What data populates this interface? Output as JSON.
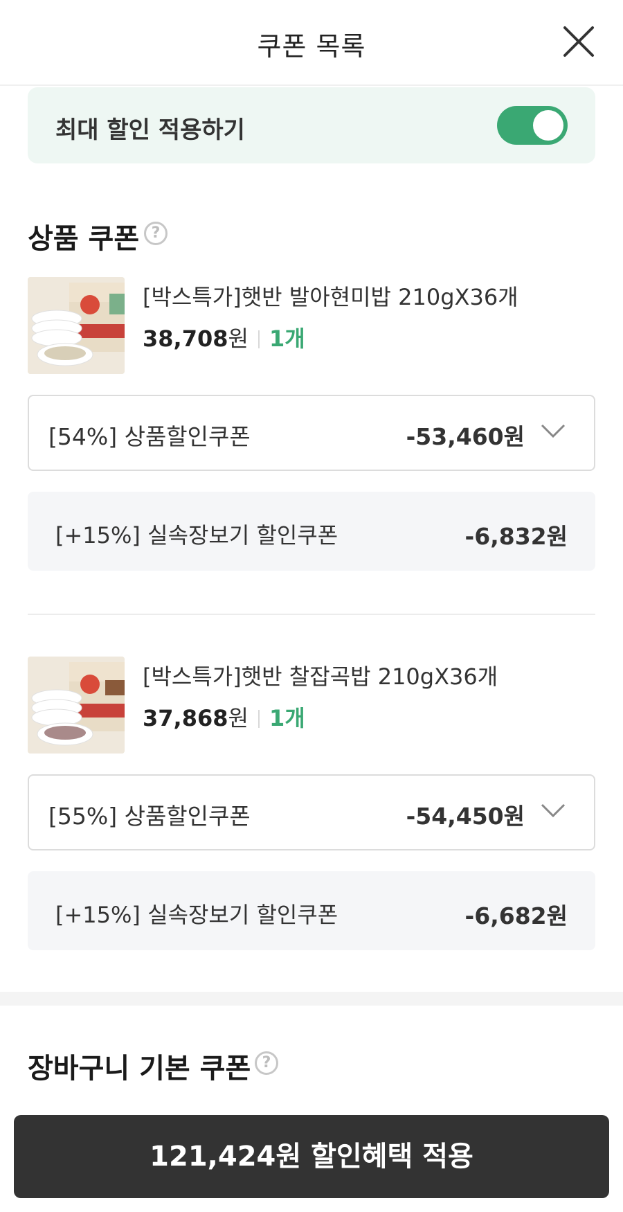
{
  "header": {
    "title": "쿠폰 목록"
  },
  "max_discount": {
    "label": "최대 할인 적용하기",
    "enabled": true
  },
  "product_coupon_section": {
    "title": "상품 쿠폰",
    "help": "?",
    "items": [
      {
        "name": "[박스특가]햇반 발아현미밥 210gX36개",
        "price": "38,708",
        "currency": "원",
        "quantity": "1개",
        "selected_coupon": {
          "name": "[54%] 상품할인쿠폰",
          "amount": "-53,460원"
        },
        "extra_coupon": {
          "name": "[+15%] 실속장보기 할인쿠폰",
          "amount": "-6,832원"
        }
      },
      {
        "name": "[박스특가]햇반 찰잡곡밥 210gX36개",
        "price": "37,868",
        "currency": "원",
        "quantity": "1개",
        "selected_coupon": {
          "name": "[55%] 상품할인쿠폰",
          "amount": "-54,450원"
        },
        "extra_coupon": {
          "name": "[+15%] 실속장보기 할인쿠폰",
          "amount": "-6,682원"
        }
      }
    ]
  },
  "cart_coupon_section": {
    "title": "장바구니 기본 쿠폰",
    "help": "?"
  },
  "apply_button": {
    "label": "121,424원 할인혜택 적용"
  },
  "colors": {
    "accent": "#3aa873",
    "toggle_bg": "#eef7f3",
    "button_bg": "#333333"
  }
}
